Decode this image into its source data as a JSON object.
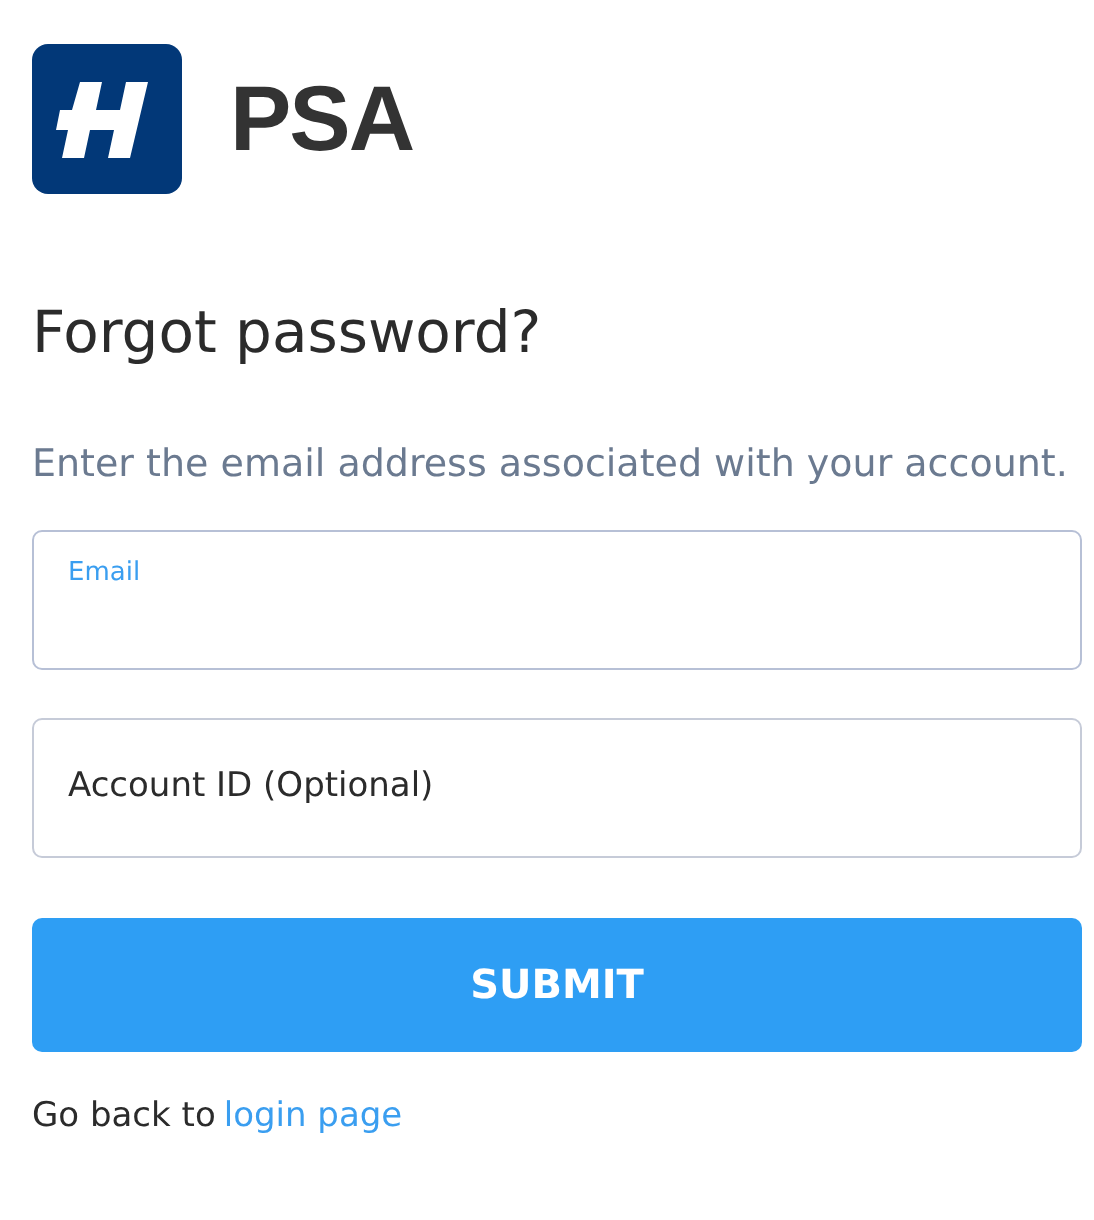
{
  "brand": {
    "name": "PSA"
  },
  "heading": "Forgot password?",
  "description": "Enter the email address associated with your account.",
  "fields": [
    {
      "label": "Email",
      "focused": true
    },
    {
      "label": "Account ID (Optional)",
      "focused": false
    }
  ],
  "submit_button": "SUBMIT",
  "footer": {
    "text": "Go back to",
    "link": "login page"
  }
}
